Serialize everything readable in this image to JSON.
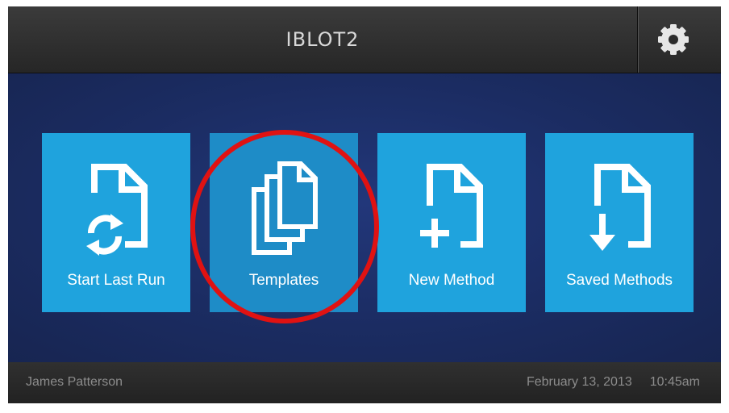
{
  "header": {
    "title": "IBLOT2",
    "settings_icon": "gear-icon"
  },
  "tiles": [
    {
      "label": "Start Last Run",
      "icon": "document-refresh-icon"
    },
    {
      "label": "Templates",
      "icon": "document-stack-icon"
    },
    {
      "label": "New Method",
      "icon": "document-add-icon"
    },
    {
      "label": "Saved Methods",
      "icon": "document-download-icon"
    }
  ],
  "footer": {
    "user": "James Patterson",
    "date": "February 13, 2013",
    "time": "10:45am"
  },
  "colors": {
    "background": "#1b2b5c",
    "tile": "#1fa3dd",
    "tile_highlighted": "#1e8cc7",
    "annotation_circle": "#e01212"
  }
}
